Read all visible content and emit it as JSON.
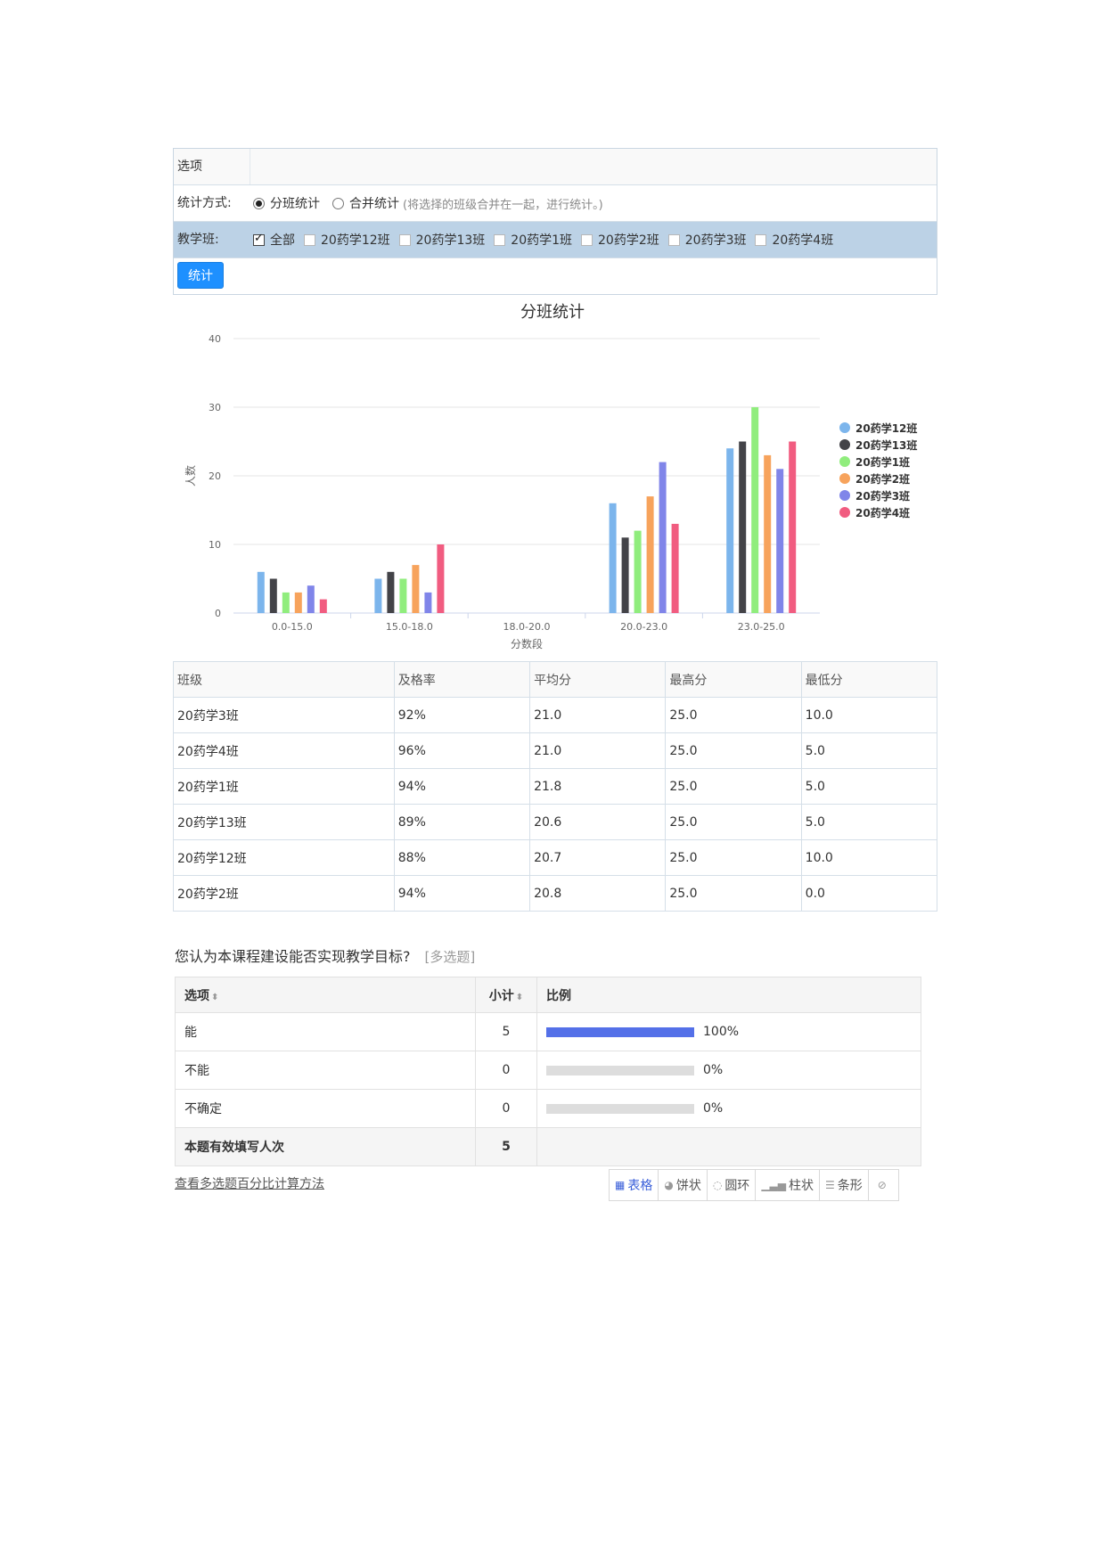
{
  "options": {
    "header": "选项",
    "stat_mode": {
      "label": "统计方式:",
      "option_separate": "分班统计",
      "option_merge": "合并统计",
      "hint": "(将选择的班级合并在一起，进行统计。)"
    },
    "classes": {
      "label": "教学班:",
      "items": [
        "全部",
        "20药学12班",
        "20药学13班",
        "20药学1班",
        "20药学2班",
        "20药学3班",
        "20药学4班"
      ],
      "checked": [
        true,
        false,
        false,
        false,
        false,
        false,
        false
      ]
    },
    "submit_label": "统计"
  },
  "chart_data": {
    "type": "bar",
    "title": "分班统计",
    "xlabel": "分数段",
    "ylabel": "人数",
    "ylim": [
      0,
      40
    ],
    "yticks": [
      0,
      10,
      20,
      30,
      40
    ],
    "categories": [
      "0.0-15.0",
      "15.0-18.0",
      "18.0-20.0",
      "20.0-23.0",
      "23.0-25.0"
    ],
    "series": [
      {
        "name": "20药学12班",
        "color": "#7cb5ec",
        "values": [
          6,
          5,
          0,
          16,
          24
        ]
      },
      {
        "name": "20药学13班",
        "color": "#434348",
        "values": [
          5,
          6,
          0,
          11,
          25
        ]
      },
      {
        "name": "20药学1班",
        "color": "#90ed7d",
        "values": [
          3,
          5,
          0,
          12,
          30
        ]
      },
      {
        "name": "20药学2班",
        "color": "#f7a35c",
        "values": [
          3,
          7,
          0,
          17,
          23
        ]
      },
      {
        "name": "20药学3班",
        "color": "#8085e9",
        "values": [
          4,
          3,
          0,
          22,
          21
        ]
      },
      {
        "name": "20药学4班",
        "color": "#f15c80",
        "values": [
          2,
          10,
          0,
          13,
          25
        ]
      }
    ],
    "grid": true,
    "legend": "right"
  },
  "score_table": {
    "headers": [
      "班级",
      "及格率",
      "平均分",
      "最高分",
      "最低分"
    ],
    "rows": [
      [
        "20药学3班",
        "92%",
        "21.0",
        "25.0",
        "10.0"
      ],
      [
        "20药学4班",
        "96%",
        "21.0",
        "25.0",
        "5.0"
      ],
      [
        "20药学1班",
        "94%",
        "21.8",
        "25.0",
        "5.0"
      ],
      [
        "20药学13班",
        "89%",
        "20.6",
        "25.0",
        "5.0"
      ],
      [
        "20药学12班",
        "88%",
        "20.7",
        "25.0",
        "10.0"
      ],
      [
        "20药学2班",
        "94%",
        "20.8",
        "25.0",
        "0.0"
      ]
    ]
  },
  "survey": {
    "question": "您认为本课程建设能否实现教学目标?",
    "type_tag": "[多选题]",
    "headers": {
      "option": "选项",
      "count": "小计",
      "ratio": "比例"
    },
    "rows": [
      {
        "option": "能",
        "count": "5",
        "percent": "100%",
        "fraction": 1.0
      },
      {
        "option": "不能",
        "count": "0",
        "percent": "0%",
        "fraction": 0.0
      },
      {
        "option": "不确定",
        "count": "0",
        "percent": "0%",
        "fraction": 0.0
      }
    ],
    "total_label": "本题有效填写人次",
    "total_count": "5",
    "calc_link": "查看多选题百分比计算方法",
    "views": [
      {
        "key": "table",
        "label": "表格",
        "icon": "table-icon",
        "glyph": "▦",
        "active": true
      },
      {
        "key": "pie",
        "label": "饼状",
        "icon": "pie-icon",
        "glyph": "◕",
        "active": false
      },
      {
        "key": "ring",
        "label": "圆环",
        "icon": "ring-icon",
        "glyph": "◌",
        "active": false
      },
      {
        "key": "column",
        "label": "柱状",
        "icon": "column-chart-icon",
        "glyph": "▁▃▅",
        "active": false
      },
      {
        "key": "bar",
        "label": "条形",
        "icon": "bar-chart-icon",
        "glyph": "☰",
        "active": false
      },
      {
        "key": "hide",
        "label": "",
        "icon": "hide-icon",
        "glyph": "⊘",
        "active": false
      }
    ]
  }
}
